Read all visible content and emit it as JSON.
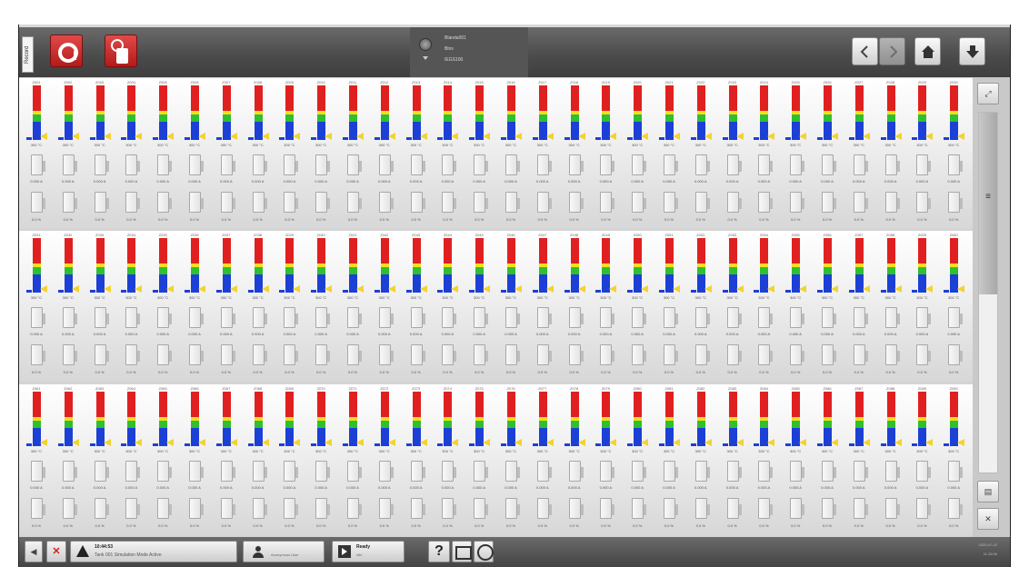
{
  "topbar": {
    "side_tab_label": "Record",
    "status": {
      "line1": "Blanda001",
      "line2": "Blns",
      "line3": "IEGS100"
    }
  },
  "zones": {
    "sections": [
      {
        "id": "Alpha",
        "labels": [
          "Z001",
          "Z002",
          "Z003",
          "Z004",
          "Z005",
          "Z006",
          "Z007",
          "Z008",
          "Z009",
          "Z010",
          "Z011",
          "Z012",
          "Z013",
          "Z014",
          "Z015",
          "Z016",
          "Z017",
          "Z018",
          "Z019",
          "Z020",
          "Z021",
          "Z022",
          "Z023",
          "Z024",
          "Z025",
          "Z026",
          "Z027",
          "Z028",
          "Z029",
          "Z030"
        ]
      },
      {
        "id": "Beta",
        "labels": [
          "Z031",
          "Z032",
          "Z033",
          "Z034",
          "Z035",
          "Z036",
          "Z037",
          "Z038",
          "Z039",
          "Z040",
          "Z041",
          "Z042",
          "Z043",
          "Z044",
          "Z045",
          "Z046",
          "Z047",
          "Z048",
          "Z049",
          "Z050",
          "Z051",
          "Z052",
          "Z053",
          "Z054",
          "Z055",
          "Z056",
          "Z057",
          "Z058",
          "Z059",
          "Z060"
        ]
      },
      {
        "id": "Gamma",
        "labels": [
          "Z061",
          "Z062",
          "Z063",
          "Z064",
          "Z065",
          "Z066",
          "Z067",
          "Z068",
          "Z069",
          "Z070",
          "Z071",
          "Z072",
          "Z073",
          "Z074",
          "Z075",
          "Z076",
          "Z077",
          "Z078",
          "Z079",
          "Z080",
          "Z081",
          "Z082",
          "Z083",
          "Z084",
          "Z085",
          "Z086",
          "Z087",
          "Z088",
          "Z089",
          "Z090"
        ]
      }
    ],
    "temp_value": "300 °C",
    "power_value": "0.000 A",
    "percent_value": "0.0 %",
    "colors": {
      "red": "#e02020",
      "yellow": "#f0e020",
      "green": "#2fbf2f",
      "blue": "#1c3fd6",
      "marker": "#f2d330"
    }
  },
  "scroll": {
    "zoom_icon": "zoom-icon",
    "grip_icon": "grip-icon"
  },
  "bottombar": {
    "alarm_time": "10:44:53",
    "alarm_text": "Tank 001 Simulation Mode Active",
    "user_name": "Anonymous User",
    "mode_label": "Ready",
    "mode_sub": "Idle",
    "help_label": "?",
    "clock_date": "2020-07-02",
    "clock_time": "11:15:06"
  }
}
